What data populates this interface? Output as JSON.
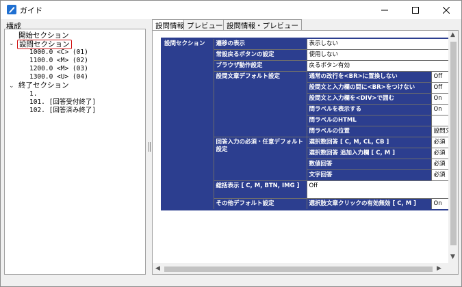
{
  "window": {
    "title": "ガイド"
  },
  "left_panel": {
    "label": "構成",
    "tree": [
      {
        "label": "開始セクション"
      },
      {
        "label": "設問セクション"
      },
      {
        "label": "1000.0 <C> (01)"
      },
      {
        "label": "1100.0 <M> (02)"
      },
      {
        "label": "1200.0 <M> (03)"
      },
      {
        "label": "1300.0 <U> (04)"
      },
      {
        "label": "終了セクション"
      },
      {
        "label": "1."
      },
      {
        "label": "101. [回答受付終了]"
      },
      {
        "label": "102. [回答済み終了]"
      }
    ]
  },
  "tabs": [
    {
      "label": "設問情報"
    },
    {
      "label": "プレビュー"
    },
    {
      "label": "設問情報・プレビュー"
    }
  ],
  "table": {
    "section_header": "設問セクション",
    "rows": [
      {
        "label": "遷移の表示",
        "value": "表示しない"
      },
      {
        "label": "常設戻るボタンの設定",
        "value": "使用しない"
      },
      {
        "label": "ブラウザ動作設定",
        "value": "戻るボタン有効"
      },
      {
        "group": "設問文章デフォルト設定",
        "items": [
          {
            "label": "通常の改行を<BR>に置換しない",
            "value": "Off"
          },
          {
            "label": "設問文と入力欄の間に<BR>をつけない",
            "value": "Off"
          },
          {
            "label": "設問文と入力欄を<DIV>で囲む",
            "value": "On"
          },
          {
            "label": "問ラベルを表示する",
            "value": "On"
          },
          {
            "label": "問ラベルのHTML",
            "value": ""
          },
          {
            "label": "問ラベルの位置",
            "value": "設問文"
          }
        ]
      },
      {
        "group": "回答入力の必須・任意デフォルト設定",
        "items": [
          {
            "label": "選択数回答 [ C, M, CL, CB ]",
            "value": "必須"
          },
          {
            "label": "選択数回答 追加入力欄 [ C, M ]",
            "value": "必須"
          },
          {
            "label": "数値回答",
            "value": "必須"
          },
          {
            "label": "文字回答",
            "value": "必須"
          }
        ]
      },
      {
        "label": "総括表示 [ C, M, BTN, IMG ]",
        "value": "Off"
      },
      {
        "group": "その他デフォルト設定",
        "items": [
          {
            "label": "選択肢文章クリックの有効無効 [ C, M ]",
            "value": "On"
          }
        ]
      }
    ]
  }
}
